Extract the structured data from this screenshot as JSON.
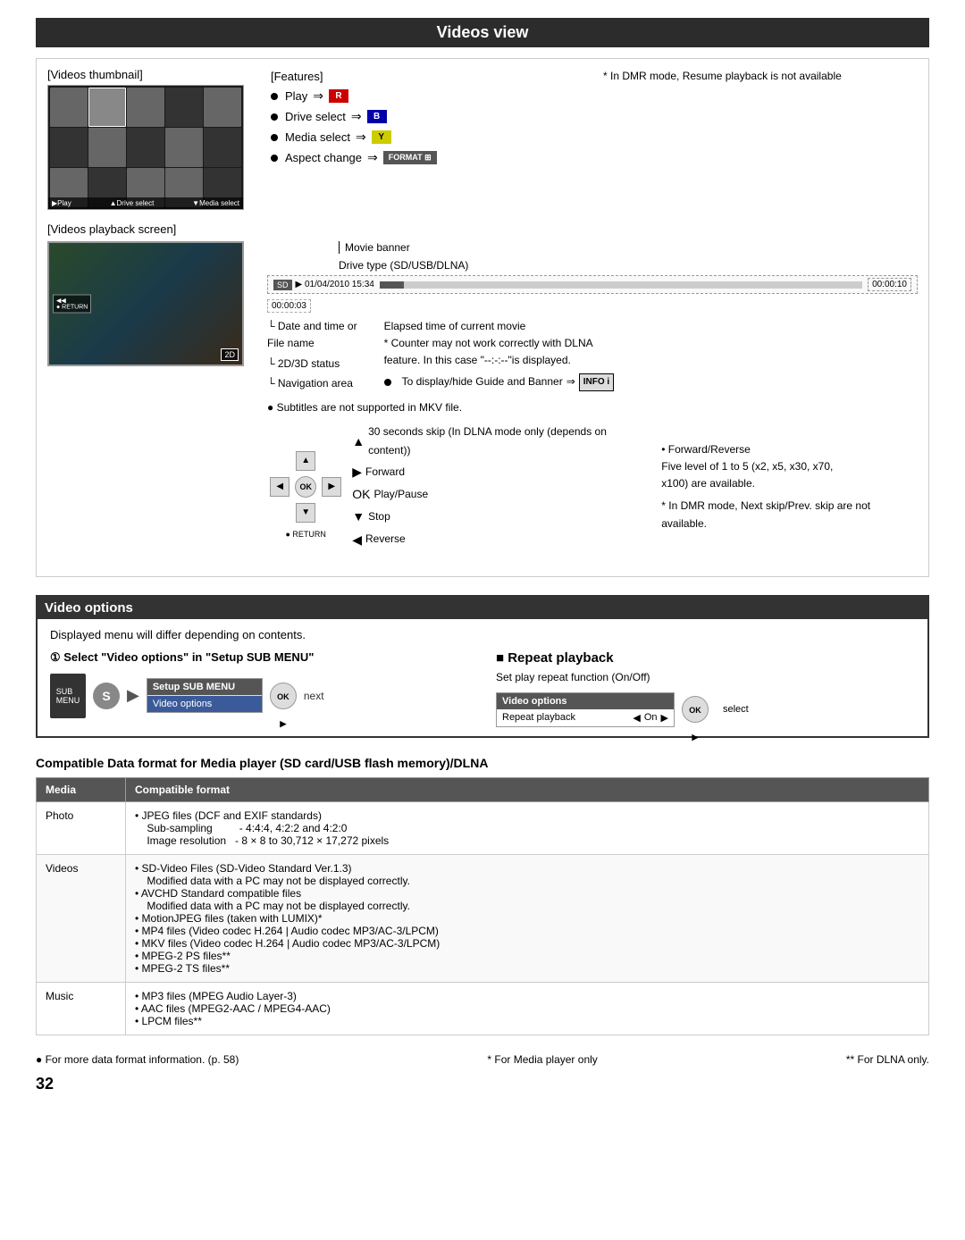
{
  "page": {
    "number": "32"
  },
  "videos_view": {
    "section_title": "Videos view",
    "thumbnail_label": "[Videos thumbnail]",
    "features_label": "[Features]",
    "features": [
      {
        "text": "Play",
        "button": "R",
        "button_class": "red"
      },
      {
        "text": "Drive select",
        "button": "B",
        "button_class": "blue"
      },
      {
        "text": "Media select",
        "button": "Y",
        "button_class": "yellow"
      },
      {
        "text": "Aspect change",
        "button": "FORMAT",
        "button_class": "format"
      }
    ],
    "dmr_note": "* In DMR mode, Resume playback is not available",
    "playback_label": "[Videos playback screen]",
    "banner_label": "Movie banner",
    "drive_type_label": "Drive type (SD/USB/DLNA)",
    "date_file_label": "Date and time or\nFile name",
    "elapsed_label": "Elapsed time of current movie",
    "counter_note": "* Counter may not work correctly with DLNA feature. In this case \"--:--:--\"is displayed.",
    "status_2d3d": "2D/3D status",
    "nav_area": "Navigation area",
    "subtitles_note": "● Subtitles are not supported in MKV file.",
    "skip_note": "30 seconds skip (In DLNA mode only (depends on content))",
    "forward_label": "Forward",
    "play_pause_label": "Play/Pause",
    "stop_label": "Stop",
    "reverse_label": "Reverse",
    "fwd_rev_note": "• Forward/Reverse\n  Five level of 1 to 5 (x2, x5, x30, x70, x100) are available.",
    "dmr_skip_note": "* In DMR mode, Next skip/Prev. skip are not available.",
    "guide_banner_label": "To display/hide Guide and Banner"
  },
  "video_options": {
    "section_title": "Video options",
    "displayed_note": "Displayed menu will differ depending on contents.",
    "step1": "① Select \"Video options\" in \"Setup SUB MENU\"",
    "setup_sub_menu": "Setup SUB MENU",
    "menu_item": "Video options",
    "next_label": "next",
    "repeat_title": "■ Repeat playback",
    "repeat_subtitle": "Set play repeat function (On/Off)",
    "repeat_menu_header": "Video options",
    "repeat_item": "Repeat playback",
    "repeat_value": "On",
    "select_label": "select"
  },
  "compatible_table": {
    "title": "Compatible Data format for Media player (SD card/USB flash memory)/DLNA",
    "col_media": "Media",
    "col_format": "Compatible format",
    "rows": [
      {
        "media": "Photo",
        "format": "• JPEG files (DCF and EXIF standards)\n    Sub-sampling        - 4:4:4, 4:2:2 and 4:2:0\n    Image resolution  - 8 × 8 to 30,712 × 17,272 pixels"
      },
      {
        "media": "Videos",
        "format": "• SD-Video Files (SD-Video Standard Ver.1.3)\n    Modified data with a PC may not be displayed correctly.\n• AVCHD Standard compatible files\n    Modified data with a PC may not be displayed correctly.\n• MotionJPEG files (taken with LUMIX)*\n• MP4 files (Video codec H.264 | Audio codec MP3/AC-3/LPCM)\n• MKV files (Video codec H.264 | Audio codec MP3/AC-3/LPCM)\n• MPEG-2 PS files**\n• MPEG-2 TS files**"
      },
      {
        "media": "Music",
        "format": "• MP3 files (MPEG Audio Layer-3)\n• AAC files (MPEG2-AAC / MPEG4-AAC)\n• LPCM files**"
      }
    ]
  },
  "footer": {
    "more_info": "● For more data format information. (p. 58)",
    "media_only": "* For Media player only",
    "dlna_only": "** For DLNA only."
  }
}
